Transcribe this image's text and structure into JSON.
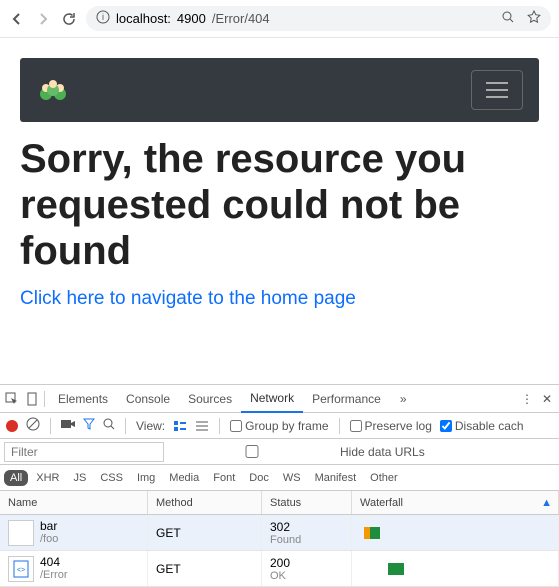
{
  "browser": {
    "url_host": "localhost:",
    "url_port": "4900",
    "url_path": "/Error/404"
  },
  "page": {
    "heading": "Sorry, the resource you requested could not be found",
    "home_link": "Click here to navigate to the home page"
  },
  "devtools": {
    "tabs": [
      "Elements",
      "Console",
      "Sources",
      "Network",
      "Performance"
    ],
    "active_tab": "Network",
    "toolbar": {
      "view_label": "View:",
      "group_label": "Group by frame",
      "preserve_label": "Preserve log",
      "disable_label": "Disable cach"
    },
    "filter_placeholder": "Filter",
    "hide_urls_label": "Hide data URLs",
    "types": [
      "All",
      "XHR",
      "JS",
      "CSS",
      "Img",
      "Media",
      "Font",
      "Doc",
      "WS",
      "Manifest",
      "Other"
    ],
    "active_type": "All",
    "columns": {
      "name": "Name",
      "method": "Method",
      "status": "Status",
      "waterfall": "Waterfall"
    },
    "rows": [
      {
        "name": "bar",
        "path": "/foo",
        "method": "GET",
        "status_code": "302",
        "status_text": "Found",
        "wf_color1": "#f29900",
        "wf_color2": "#1e8e3e",
        "icon": "blank"
      },
      {
        "name": "404",
        "path": "/Error",
        "method": "GET",
        "status_code": "200",
        "status_text": "OK",
        "wf_color1": "#1e8e3e",
        "wf_color2": "#1e8e3e",
        "icon": "doc"
      }
    ]
  }
}
